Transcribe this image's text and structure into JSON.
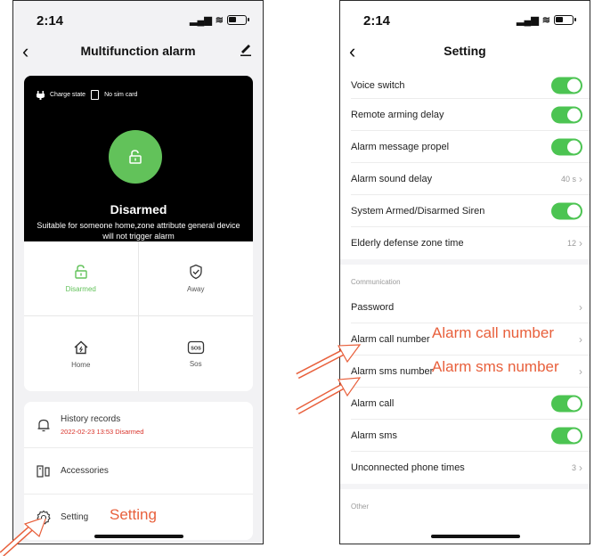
{
  "left": {
    "status_time": "2:14",
    "title": "Multifunction alarm",
    "card": {
      "charge_state": "Charge state",
      "sim": "No sim card",
      "state_title": "Disarmed",
      "state_desc": "Suitable for someone home,zone attribute general device will not trigger alarm"
    },
    "modes": [
      {
        "label": "Disarmed",
        "icon": "unlock-icon"
      },
      {
        "label": "Away",
        "icon": "shield-check-icon"
      },
      {
        "label": "Home",
        "icon": "home-icon"
      },
      {
        "label": "Sos",
        "icon": "sos-icon"
      }
    ],
    "menu": {
      "history_label": "History records",
      "history_sub": "2022-02-23 13:53 Disarmed",
      "accessories_label": "Accessories",
      "setting_label": "Setting"
    },
    "annotation": "Setting"
  },
  "right": {
    "status_time": "2:14",
    "title": "Setting",
    "rows_top": [
      {
        "label": "Voice switch",
        "type": "toggle",
        "on": true
      },
      {
        "label": "Remote  arming delay",
        "type": "toggle",
        "on": true
      },
      {
        "label": "Alarm message propel",
        "type": "toggle",
        "on": true
      },
      {
        "label": "Alarm sound delay",
        "type": "value",
        "value": "40 s"
      },
      {
        "label": "System Armed/Disarmed Siren",
        "type": "toggle",
        "on": true
      },
      {
        "label": "Elderly defense zone time",
        "type": "value",
        "value": "12"
      }
    ],
    "section_communication": "Communication",
    "rows_comm": [
      {
        "label": "Password",
        "type": "chevron"
      },
      {
        "label": "Alarm call number",
        "type": "chevron"
      },
      {
        "label": "Alarm sms number",
        "type": "chevron"
      },
      {
        "label": "Alarm call",
        "type": "toggle",
        "on": true
      },
      {
        "label": "Alarm sms",
        "type": "toggle",
        "on": true
      },
      {
        "label": "Unconnected phone times",
        "type": "value",
        "value": "3"
      }
    ],
    "section_other": "Other",
    "annotation_call": "Alarm call number",
    "annotation_sms": "Alarm sms number"
  },
  "colors": {
    "accent_green": "#62c25a",
    "toggle_green": "#4cc452",
    "annotation_orange": "#e8603c",
    "history_red": "#d9342b"
  }
}
